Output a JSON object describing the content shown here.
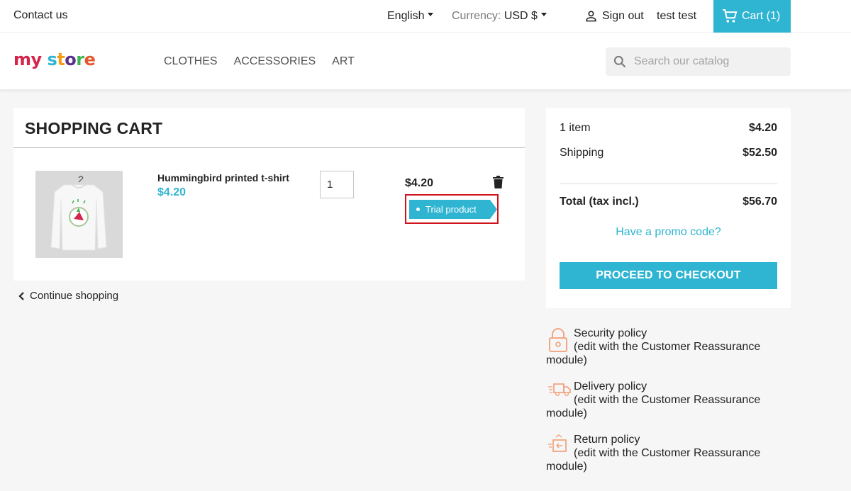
{
  "topnav": {
    "contact": "Contact us",
    "language": "English",
    "currency_label": "Currency:",
    "currency_value": "USD $",
    "signout": "Sign out",
    "username": "test test",
    "cart": "Cart (1)"
  },
  "header": {
    "logo": [
      "my",
      " ",
      "s",
      "t",
      "o",
      "r",
      "e"
    ],
    "menu": [
      "CLOTHES",
      "ACCESSORIES",
      "ART"
    ],
    "search_placeholder": "Search our catalog"
  },
  "cart": {
    "title": "SHOPPING CART",
    "item": {
      "name": "Hummingbird printed t-shirt",
      "unit_price": "$4.20",
      "quantity": "1",
      "line_total": "$4.20",
      "badge": "Trial product"
    },
    "continue": "Continue shopping"
  },
  "summary": {
    "items_label": "1 item",
    "items_value": "$4.20",
    "shipping_label": "Shipping",
    "shipping_value": "$52.50",
    "total_label": "Total (tax incl.)",
    "total_value": "$56.70",
    "promo": "Have a promo code?",
    "checkout": "PROCEED TO CHECKOUT"
  },
  "reassurance": [
    {
      "title": "Security policy",
      "desc_line1": "(edit with the Customer Reassurance",
      "desc_line2": "module)",
      "icon": "lock-icon"
    },
    {
      "title": "Delivery policy",
      "desc_line1": "(edit with the Customer Reassurance",
      "desc_line2": "module)",
      "icon": "truck-icon"
    },
    {
      "title": "Return policy",
      "desc_line1": "(edit with the Customer Reassurance",
      "desc_line2": "module)",
      "icon": "return-box-icon"
    }
  ],
  "colors": {
    "accent": "#2fb5d2",
    "highlight_border": "#d0121c",
    "reassurance_icon": "#f19d76"
  }
}
